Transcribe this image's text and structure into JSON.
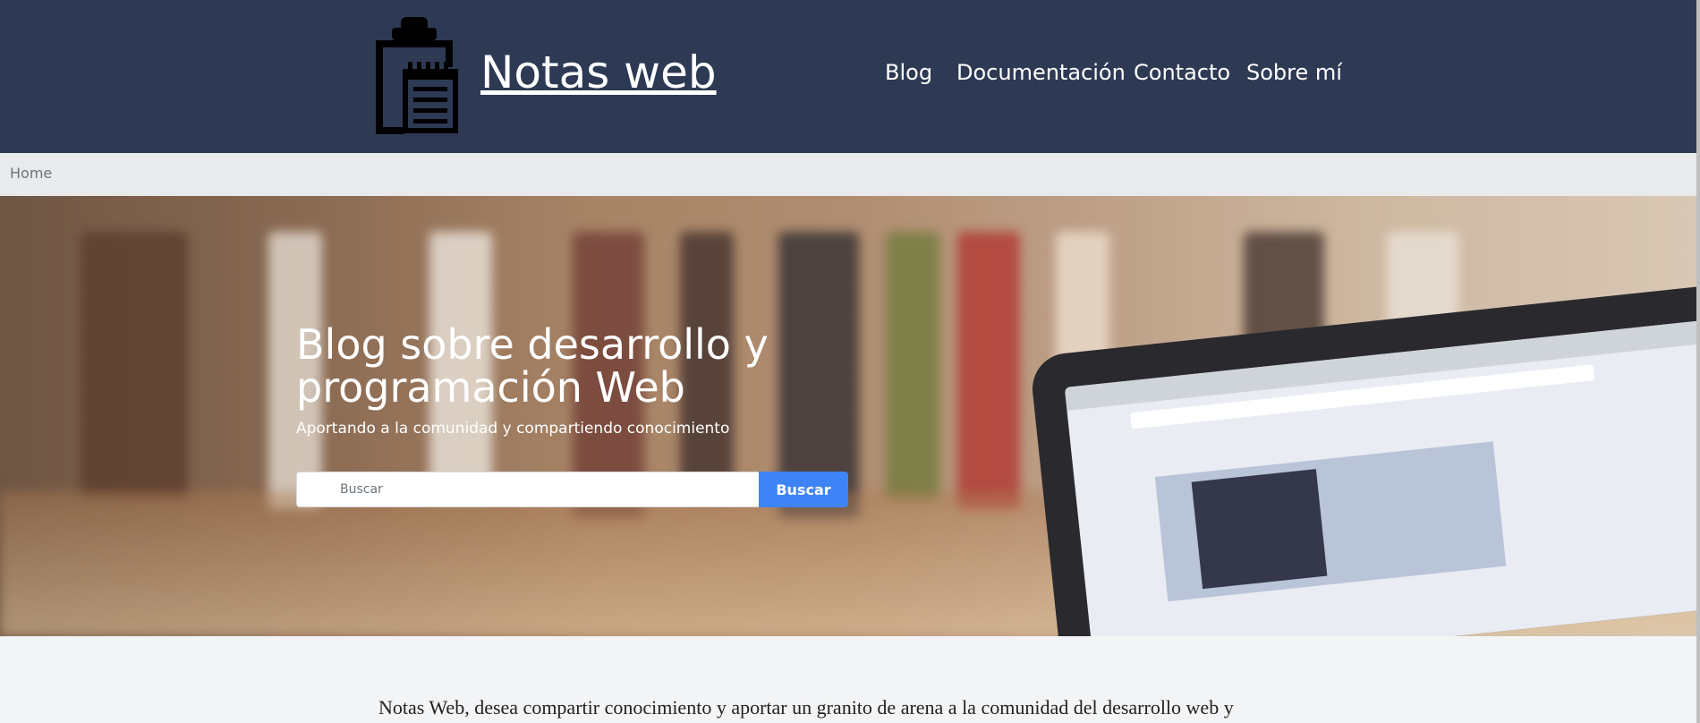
{
  "header": {
    "brand": "Notas web",
    "logo_icon": "clipboard-icon",
    "nav": [
      {
        "label": "Blog"
      },
      {
        "label": "Documentación"
      },
      {
        "label": "Contacto"
      },
      {
        "label": "Sobre mí"
      }
    ]
  },
  "breadcrumb": {
    "items": [
      {
        "label": "Home"
      }
    ]
  },
  "hero": {
    "title": "Blog sobre desarrollo y programación Web",
    "subtitle": "Aportando a la comunidad y compartiendo conocimiento",
    "search": {
      "placeholder": "Buscar",
      "value": "",
      "button_label": "Buscar"
    }
  },
  "intro": {
    "text": "Notas Web, desea compartir conocimiento y aportar un granito de arena a la comunidad del desarrollo web y"
  },
  "colors": {
    "header_bg": "#2e3a54",
    "breadcrumb_bg": "#e8eaec",
    "button_bg": "#3f84f7",
    "page_bg": "#f3f4f6"
  }
}
